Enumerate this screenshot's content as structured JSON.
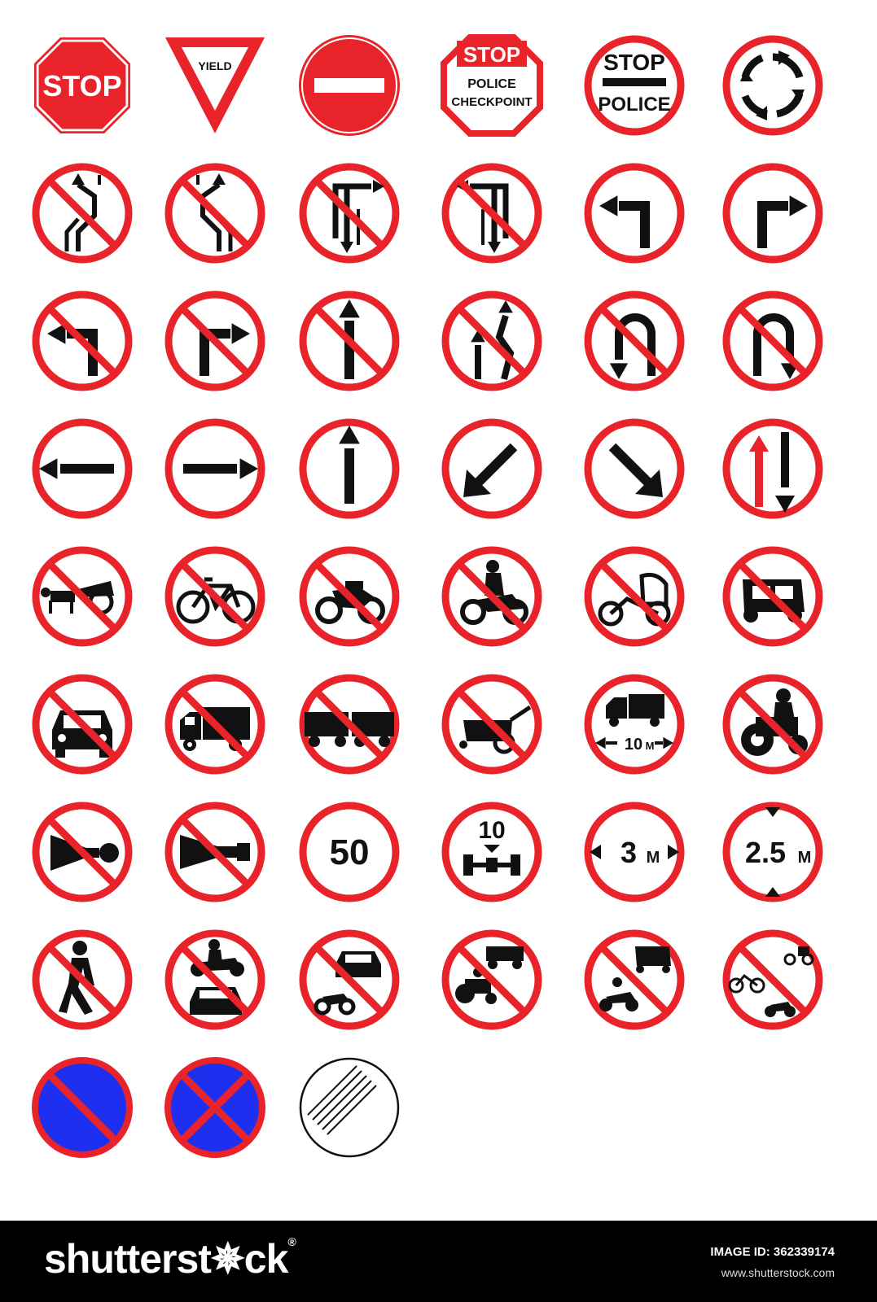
{
  "signs": [
    {
      "id": "stop",
      "kind": "octagon",
      "texts": [
        "STOP"
      ]
    },
    {
      "id": "yield",
      "kind": "triangle",
      "texts": [
        "YIELD"
      ]
    },
    {
      "id": "no-entry",
      "kind": "noentry"
    },
    {
      "id": "stop-police-checkpoint",
      "kind": "octagon-outline",
      "texts": [
        "STOP",
        "POLICE",
        "CHECKPOINT"
      ]
    },
    {
      "id": "stop-police",
      "kind": "circle",
      "texts": [
        "STOP",
        "POLICE"
      ]
    },
    {
      "id": "roundabout",
      "kind": "circle",
      "icon": "roundabout"
    },
    {
      "id": "no-lane-change-left",
      "kind": "circle-slash",
      "icon": "lane-shift-left"
    },
    {
      "id": "no-lane-change-right",
      "kind": "circle-slash",
      "icon": "lane-shift-right"
    },
    {
      "id": "no-right-turn-ahead",
      "kind": "circle-slash",
      "icon": "t-right"
    },
    {
      "id": "no-left-turn-ahead",
      "kind": "circle-slash",
      "icon": "t-left"
    },
    {
      "id": "turn-left",
      "kind": "circle",
      "icon": "turn-left"
    },
    {
      "id": "turn-right",
      "kind": "circle",
      "icon": "turn-right"
    },
    {
      "id": "no-left-turn",
      "kind": "circle-slash",
      "icon": "left-turn"
    },
    {
      "id": "no-right-turn",
      "kind": "circle-slash",
      "icon": "right-turn"
    },
    {
      "id": "no-straight",
      "kind": "circle-slash",
      "icon": "straight"
    },
    {
      "id": "no-overtaking",
      "kind": "circle-slash",
      "icon": "overtake"
    },
    {
      "id": "no-u-turn-left",
      "kind": "circle-slash",
      "icon": "u-turn-left"
    },
    {
      "id": "no-u-turn-right",
      "kind": "circle-slash",
      "icon": "u-turn-right"
    },
    {
      "id": "go-left",
      "kind": "circle",
      "icon": "arrow-left"
    },
    {
      "id": "go-right",
      "kind": "circle",
      "icon": "arrow-right"
    },
    {
      "id": "go-straight",
      "kind": "circle",
      "icon": "arrow-up"
    },
    {
      "id": "keep-left",
      "kind": "circle",
      "icon": "arrow-down-left"
    },
    {
      "id": "keep-right",
      "kind": "circle",
      "icon": "arrow-down-right"
    },
    {
      "id": "priority-oncoming",
      "kind": "circle",
      "icon": "two-way"
    },
    {
      "id": "no-cart",
      "kind": "circle-slash",
      "icon": "cart"
    },
    {
      "id": "no-bicycle",
      "kind": "circle-slash",
      "icon": "bicycle"
    },
    {
      "id": "no-motorcycle",
      "kind": "circle-slash",
      "icon": "motorcycle"
    },
    {
      "id": "no-motorbike-rider",
      "kind": "circle-slash",
      "icon": "rider"
    },
    {
      "id": "no-tricycle",
      "kind": "circle-slash",
      "icon": "tricycle"
    },
    {
      "id": "no-tuktuk",
      "kind": "circle-slash",
      "icon": "tuktuk"
    },
    {
      "id": "no-cars",
      "kind": "circle-slash",
      "icon": "car-front"
    },
    {
      "id": "no-trucks",
      "kind": "circle-slash",
      "icon": "truck"
    },
    {
      "id": "no-trailers",
      "kind": "circle-slash",
      "icon": "trailer"
    },
    {
      "id": "no-handcart",
      "kind": "circle-slash",
      "icon": "handcart"
    },
    {
      "id": "length-limit",
      "kind": "circle",
      "icon": "truck-length",
      "texts": [
        "10",
        "M"
      ]
    },
    {
      "id": "no-tractor",
      "kind": "circle-slash",
      "icon": "tractor"
    },
    {
      "id": "no-horn",
      "kind": "circle-slash",
      "icon": "horn"
    },
    {
      "id": "no-air-horn",
      "kind": "circle-slash",
      "icon": "airhorn"
    },
    {
      "id": "speed-limit",
      "kind": "circle",
      "texts": [
        "50"
      ]
    },
    {
      "id": "axle-weight",
      "kind": "circle",
      "icon": "axle",
      "texts": [
        "10"
      ]
    },
    {
      "id": "width-limit",
      "kind": "circle",
      "icon": "width-arrows",
      "texts": [
        "3",
        "M"
      ]
    },
    {
      "id": "height-limit",
      "kind": "circle",
      "icon": "height-arrows",
      "texts": [
        "2.5",
        "M"
      ]
    },
    {
      "id": "no-pedestrians",
      "kind": "circle-slash",
      "icon": "pedestrian"
    },
    {
      "id": "no-motorbike-and-car",
      "kind": "circle-slash",
      "icon": "rider-car"
    },
    {
      "id": "no-car-and-motorbike",
      "kind": "circle-slash",
      "icon": "car-moto"
    },
    {
      "id": "no-tractor-trailer",
      "kind": "circle-slash",
      "icon": "tractor-trailer"
    },
    {
      "id": "no-tuktuk-moto",
      "kind": "circle-slash",
      "icon": "tuktuk-rider"
    },
    {
      "id": "no-bikes-rickshaw",
      "kind": "circle-slash",
      "icon": "bikes-rickshaw"
    },
    {
      "id": "no-parking",
      "kind": "blue-slash"
    },
    {
      "id": "no-stopping",
      "kind": "blue-cross"
    },
    {
      "id": "end-restrictions",
      "kind": "end"
    }
  ],
  "colors": {
    "red": "#e8232a",
    "black": "#111111",
    "blue": "#1f2ff0",
    "white": "#ffffff"
  },
  "footer": {
    "brand": "shutterst✵ck",
    "brand_mark": "®",
    "image_id_label": "IMAGE ID: 362339174",
    "website": "www.shutterstock.com"
  }
}
